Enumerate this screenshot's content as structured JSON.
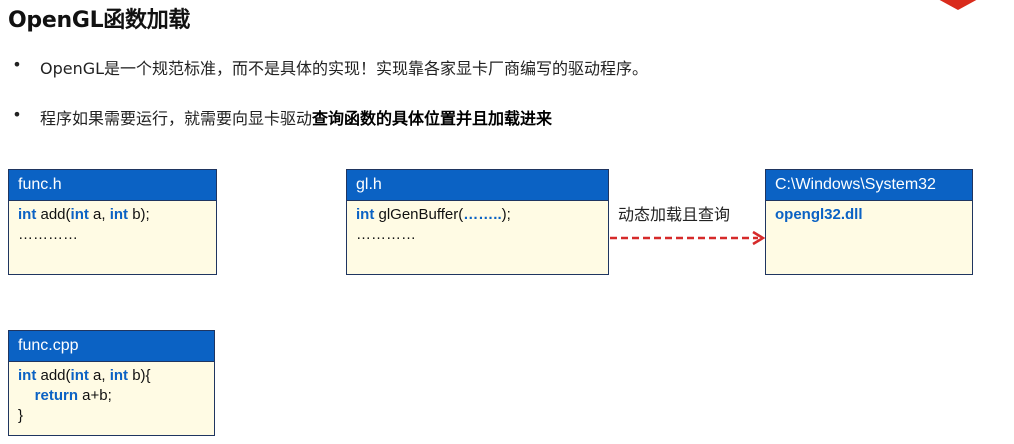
{
  "title": "OpenGL函数加载",
  "bullets": [
    {
      "marker": "•",
      "text": "OpenGL是一个规范标准，而不是具体的实现！实现靠各家显卡厂商编写的驱动程序。"
    },
    {
      "marker": "•",
      "text": "程序如果需要运行，就需要向显卡驱动",
      "bold": "查询函数的具体位置并且加载进来"
    }
  ],
  "boxes": {
    "func_h": {
      "header": "func.h",
      "kw_int": "int",
      "line1_a": " add(",
      "line1_b": " a, ",
      "line1_c": " b);",
      "line2": "…………"
    },
    "gl_h": {
      "header": "gl.h",
      "kw_int": "int",
      "line1_a": " glGenBuffer(",
      "line1_dots": "……..",
      "line1_b": ");",
      "line2": "…………"
    },
    "system32": {
      "header": "C:\\Windows\\System32",
      "dll": "opengl32.dll"
    },
    "func_cpp": {
      "header": "func.cpp",
      "kw_int": "int",
      "line1_a": " add(",
      "line1_b": " a, ",
      "line1_c": " b){",
      "kw_return": "return",
      "line2_rest": " a+b;",
      "line3": "}"
    }
  },
  "arrow_label": "动态加载且查询",
  "colors": {
    "accent": "#0b62c4",
    "box_fill": "#fffbe4",
    "arrow": "#d62a2a",
    "corner": "#d92b1c"
  }
}
